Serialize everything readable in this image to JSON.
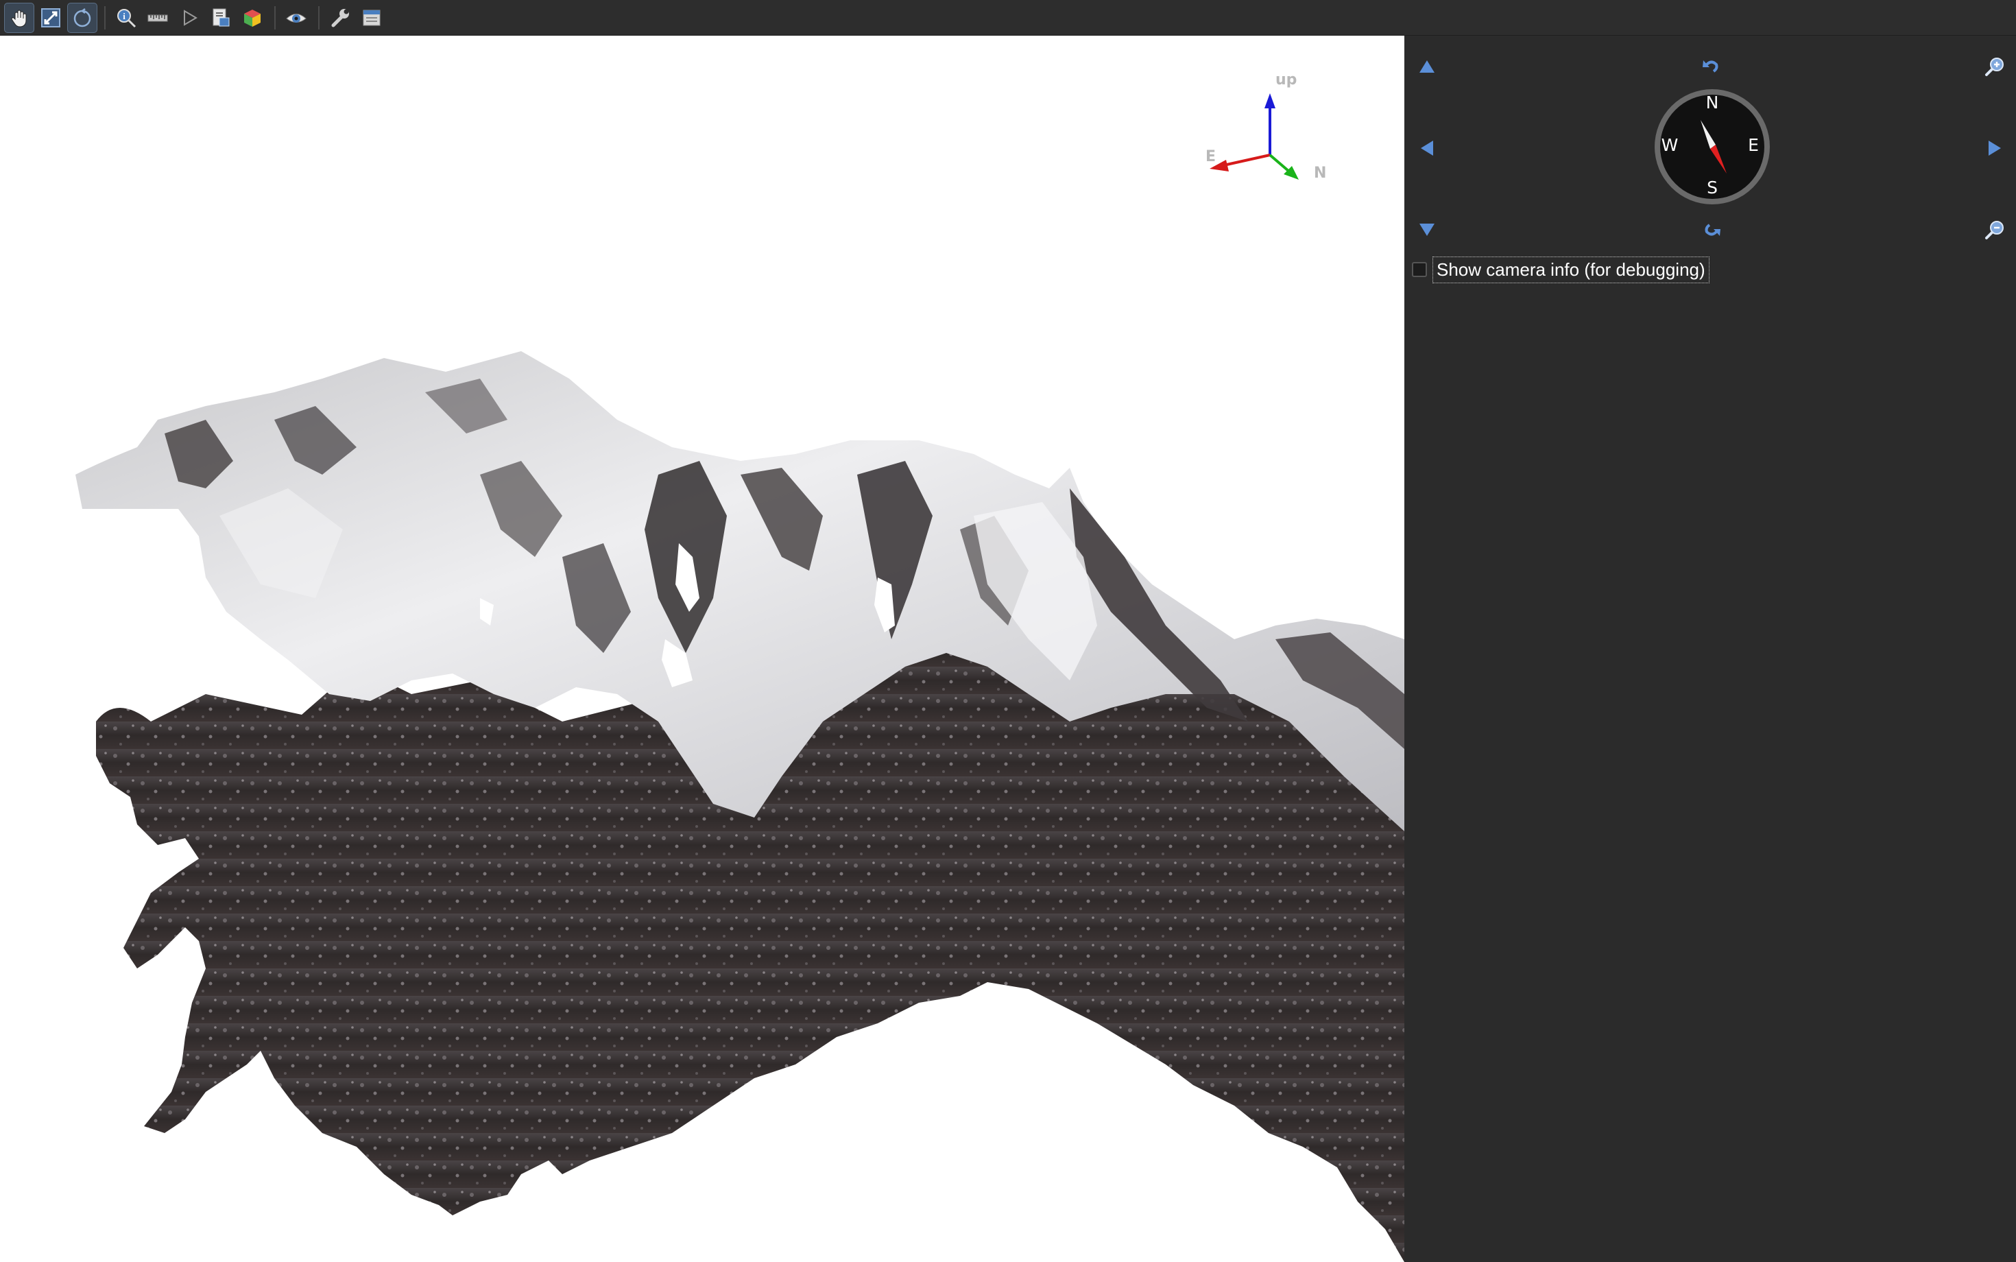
{
  "toolbar": {
    "tools": [
      {
        "name": "pan-tool-icon",
        "active": true
      },
      {
        "name": "zoom-to-extent-icon",
        "active": true
      },
      {
        "name": "rotate-tool-icon",
        "active": true
      },
      {
        "name": "identify-tool-icon",
        "active": false
      },
      {
        "name": "measure-tool-icon",
        "active": false
      },
      {
        "name": "animation-play-icon",
        "active": false
      },
      {
        "name": "save-image-icon",
        "active": false
      },
      {
        "name": "layers-3d-icon",
        "active": false
      },
      {
        "name": "camera-view-icon",
        "active": false
      },
      {
        "name": "settings-wrench-icon",
        "active": false
      },
      {
        "name": "export-scene-icon",
        "active": false
      }
    ]
  },
  "viewport": {
    "background": "#ffffff",
    "axes": {
      "up_label": "up",
      "east_label": "E",
      "north_label": "N",
      "up_color": "#1a1ad6",
      "east_color": "#d61a1a",
      "north_color": "#1ab31a"
    }
  },
  "nav": {
    "compass": {
      "north": "N",
      "south": "S",
      "east": "E",
      "west": "W"
    },
    "buttons": [
      "tilt-up",
      "rotate-ccw",
      "zoom-in",
      "pan-left",
      "pan-right",
      "tilt-down",
      "rotate-cw",
      "zoom-out"
    ],
    "accent_color": "#5b8fd8",
    "debug_checkbox": {
      "label": "Show camera info (for debugging)",
      "checked": false
    }
  }
}
